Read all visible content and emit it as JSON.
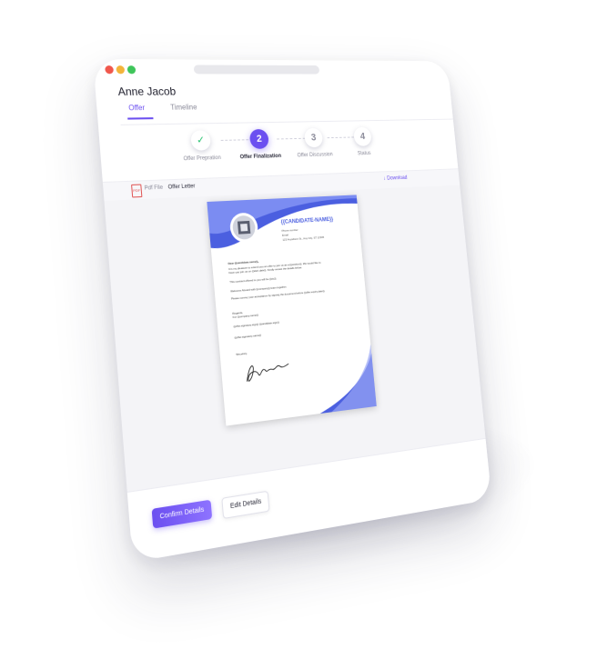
{
  "page": {
    "title": "Anne Jacob"
  },
  "tabs": [
    {
      "label": "Offer",
      "active": true
    },
    {
      "label": "Timeline",
      "active": false
    }
  ],
  "steps": [
    {
      "badge": "✓",
      "label": "Offer Prepration",
      "state": "done"
    },
    {
      "badge": "2",
      "label": "Offer Finalization",
      "state": "active"
    },
    {
      "badge": "3",
      "label": "Offer Discussion",
      "state": "pending"
    },
    {
      "badge": "4",
      "label": "Status",
      "state": "pending"
    }
  ],
  "file": {
    "type_label": "Pdf File",
    "name": "Offer Letter",
    "download_label": "Download",
    "pdf_icon_text": "PDF"
  },
  "document": {
    "candidate_name": "{{CANDIDATE-NAME}}",
    "contact_lines": [
      "Phone number",
      "Email",
      "123 Anywhere St., Any City, ST 12345"
    ],
    "body_lines": [
      "Dear {{candidate.name}},",
      "It is my pleasure to extend you an offer to join us as a {{position}}. We would like to",
      "have you join us on {{start.date}}. Kindly review the details below.",
      "This contract offered to you will be {{ctc}}.",
      "Welcome Aboard with {{company}} team together.",
      "Please convey your acceptance by signing the document before {{offer.expiry.date}}.",
      "Regards,",
      "For {{company.name}}",
      "{{offer.signatory.sign}}   {{candidate.sign}}",
      "{{offer.signatory.name}}",
      "Sincerely,"
    ]
  },
  "actions": {
    "confirm_label": "Confirm Details",
    "edit_label": "Edit Details"
  },
  "colors": {
    "accent": "#6b4ff0",
    "done": "#25c16f",
    "doc_blue": "#4b5fe0"
  }
}
